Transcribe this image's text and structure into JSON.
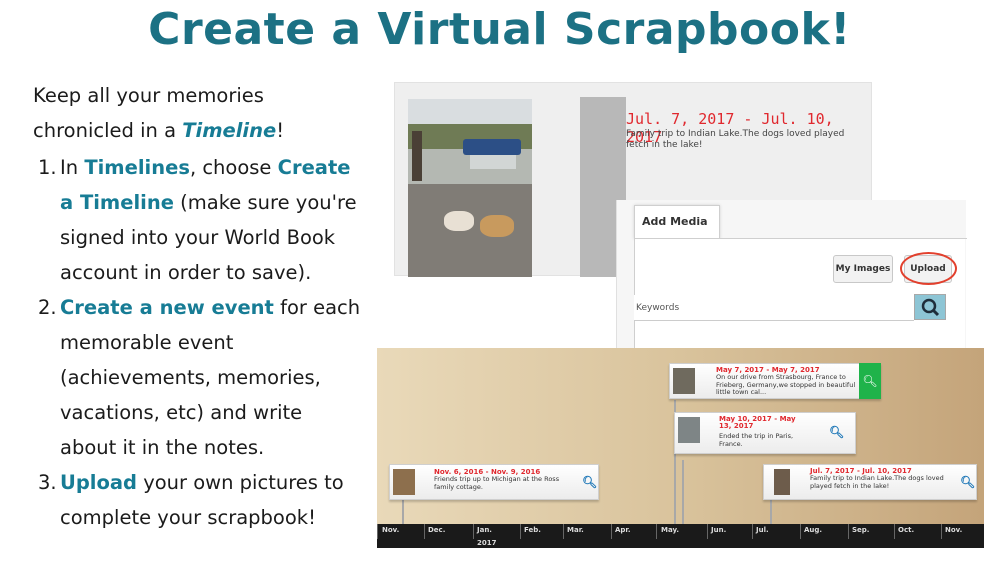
{
  "page": {
    "title": "Create a Virtual Scrapbook!",
    "intro": {
      "pre": "Keep all your memories chronicled in a ",
      "link": "Timeline",
      "post": "!"
    },
    "steps": [
      {
        "num": "1.",
        "pre": "In ",
        "link1": "Timelines",
        "mid": ", choose ",
        "link2": "Create a Timeline",
        "post": " (make sure you're signed into your World Book account in order to save)."
      },
      {
        "num": "2.",
        "pre": "",
        "link1": "Create a new event",
        "mid": " for each memorable event (achievements, memories, vacations, etc) and write about it in the notes.",
        "link2": "",
        "post": ""
      },
      {
        "num": "3.",
        "pre": "",
        "link1": "Upload",
        "mid": " your own pictures to complete your scrapbook!",
        "link2": "",
        "post": ""
      }
    ]
  },
  "shot1": {
    "date": "Jul. 7, 2017 - Jul. 10, 2017",
    "note": "Family trip to Indian Lake.The dogs loved played fetch in the lake!"
  },
  "shot2": {
    "tab": "Add Media",
    "my_images": "My Images",
    "upload": "Upload",
    "keywords_placeholder": "Keywords"
  },
  "shot3": {
    "events": [
      {
        "date": "May 7, 2017 - May 7, 2017",
        "note": "On our drive from Strasbourg, France to Frieberg, Germany,we stopped in beautiful little town cal..."
      },
      {
        "date": "May 10, 2017 - May 13, 2017",
        "note": "Ended the trip in Paris, France."
      },
      {
        "date": "Nov. 6, 2016 - Nov. 9, 2016",
        "note": "Friends trip up to Michigan at the Ross family cottage."
      },
      {
        "date": "Jul. 7, 2017 - Jul. 10, 2017",
        "note": "Family trip to Indian Lake.The dogs loved played fetch in the lake!"
      }
    ],
    "months": [
      "Nov.",
      "Dec.",
      "Jan.",
      "Feb.",
      "Mar.",
      "Apr.",
      "May.",
      "Jun.",
      "Jul.",
      "Aug.",
      "Sep.",
      "Oct.",
      "Nov."
    ],
    "year": "2017"
  },
  "colors": {
    "title": "#1c7184",
    "highlight": "#177c95",
    "date_red": "#e0282e",
    "green": "#1fb34a"
  },
  "icons": {
    "search": "search-icon",
    "magnifier": "magnifier-icon"
  }
}
